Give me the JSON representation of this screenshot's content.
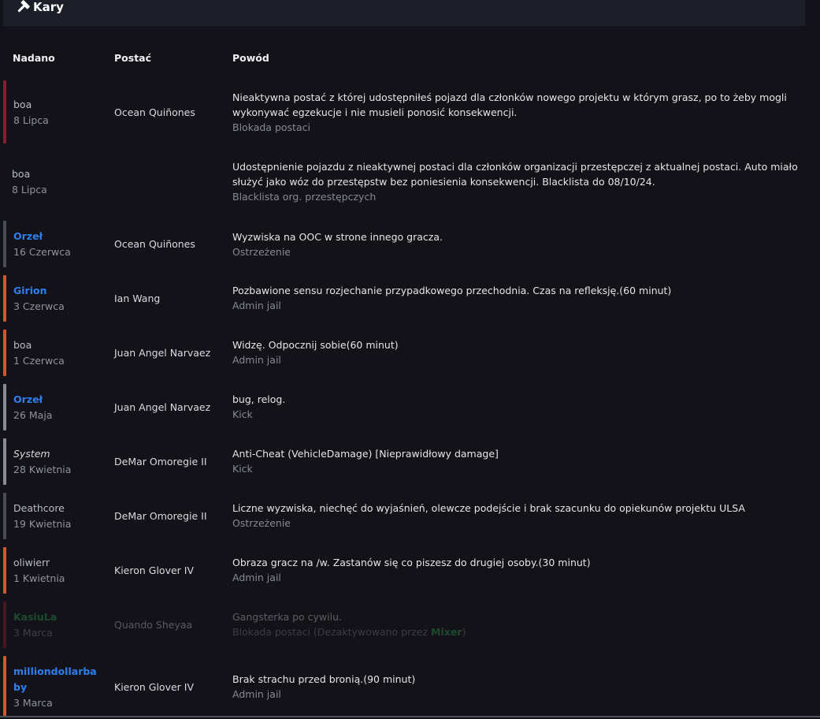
{
  "header": {
    "title": "Kary",
    "icon": "hammer-icon"
  },
  "columns": {
    "given": "Nadano",
    "character": "Postać",
    "reason": "Powód"
  },
  "colors": {
    "severe": "#8a1c2b",
    "warning": "#4a4d55",
    "jail": "#d9542b",
    "kick": "#8a8d94",
    "staff_name": "#2f7ff0",
    "inactive_name": "#32b15a"
  },
  "rows": [
    {
      "admin": "boa",
      "date": "8 Lipca",
      "character": "Ocean Quiñones",
      "reason": "Nieaktywna postać z której udostępniłeś pojazd dla członków nowego projektu w którym grasz, po to żeby mogli wykonywać egzekucje i nie musieli ponosić konsekwencji.",
      "type": "Blokada postaci"
    },
    {
      "admin": "boa",
      "date": "8 Lipca",
      "character": "",
      "reason": "Udostępnienie pojazdu z nieaktywnej postaci dla członków organizacji przestępczej z aktualnej postaci. Auto miało służyć jako wóz do przestępstw bez poniesienia konsekwencji. Blacklista do 08/10/24.",
      "type": "Blacklista org. przestępczych"
    },
    {
      "admin": "Orzeł",
      "date": "16 Czerwca",
      "character": "Ocean Quiñones",
      "reason": "Wyzwiska na OOC w strone innego gracza.",
      "type": "Ostrzeżenie"
    },
    {
      "admin": "Girion",
      "date": "3 Czerwca",
      "character": "Ian Wang",
      "reason": "Pozbawione sensu rozjechanie przypadkowego przechodnia. Czas na refleksję.(60 minut)",
      "type": "Admin jail"
    },
    {
      "admin": "boa",
      "date": "1 Czerwca",
      "character": "Juan Angel Narvaez",
      "reason": "Widzę. Odpocznij sobie(60 minut)",
      "type": "Admin jail"
    },
    {
      "admin": "Orzeł",
      "date": "26 Maja",
      "character": "Juan Angel Narvaez",
      "reason": "bug, relog.",
      "type": "Kick"
    },
    {
      "admin": "System",
      "date": "28 Kwietnia",
      "character": "DeMar Omoregie II",
      "reason": "Anti-Cheat (VehicleDamage) [Nieprawidłowy damage]",
      "type": "Kick"
    },
    {
      "admin": "Deathcore",
      "date": "19 Kwietnia",
      "character": "DeMar Omoregie II",
      "reason": "Liczne wyzwiska, niechęć do wyjaśnień, olewcze podejście i brak szacunku do opiekunów projektu ULSA",
      "type": "Ostrzeżenie"
    },
    {
      "admin": "oliwierr",
      "date": "1 Kwietnia",
      "character": "Kieron Glover IV",
      "reason": "Obraza gracz na /w. Zastanów się co piszesz do drugiej osoby.(30 minut)",
      "type": "Admin jail"
    },
    {
      "admin": "KasiuLa",
      "date": "3 Marca",
      "character": "Quando Sheyaa",
      "reason": "Gangsterka po cywilu.",
      "type": "Blokada postaci (Dezaktywowano przez ",
      "deactivated_by": "Mixer",
      "type_suffix": ")"
    },
    {
      "admin": "milliondollarbaby",
      "date": "3 Marca",
      "character": "Kieron Glover IV",
      "reason": "Brak strachu przed bronią.(90 minut)",
      "type": "Admin jail"
    }
  ]
}
